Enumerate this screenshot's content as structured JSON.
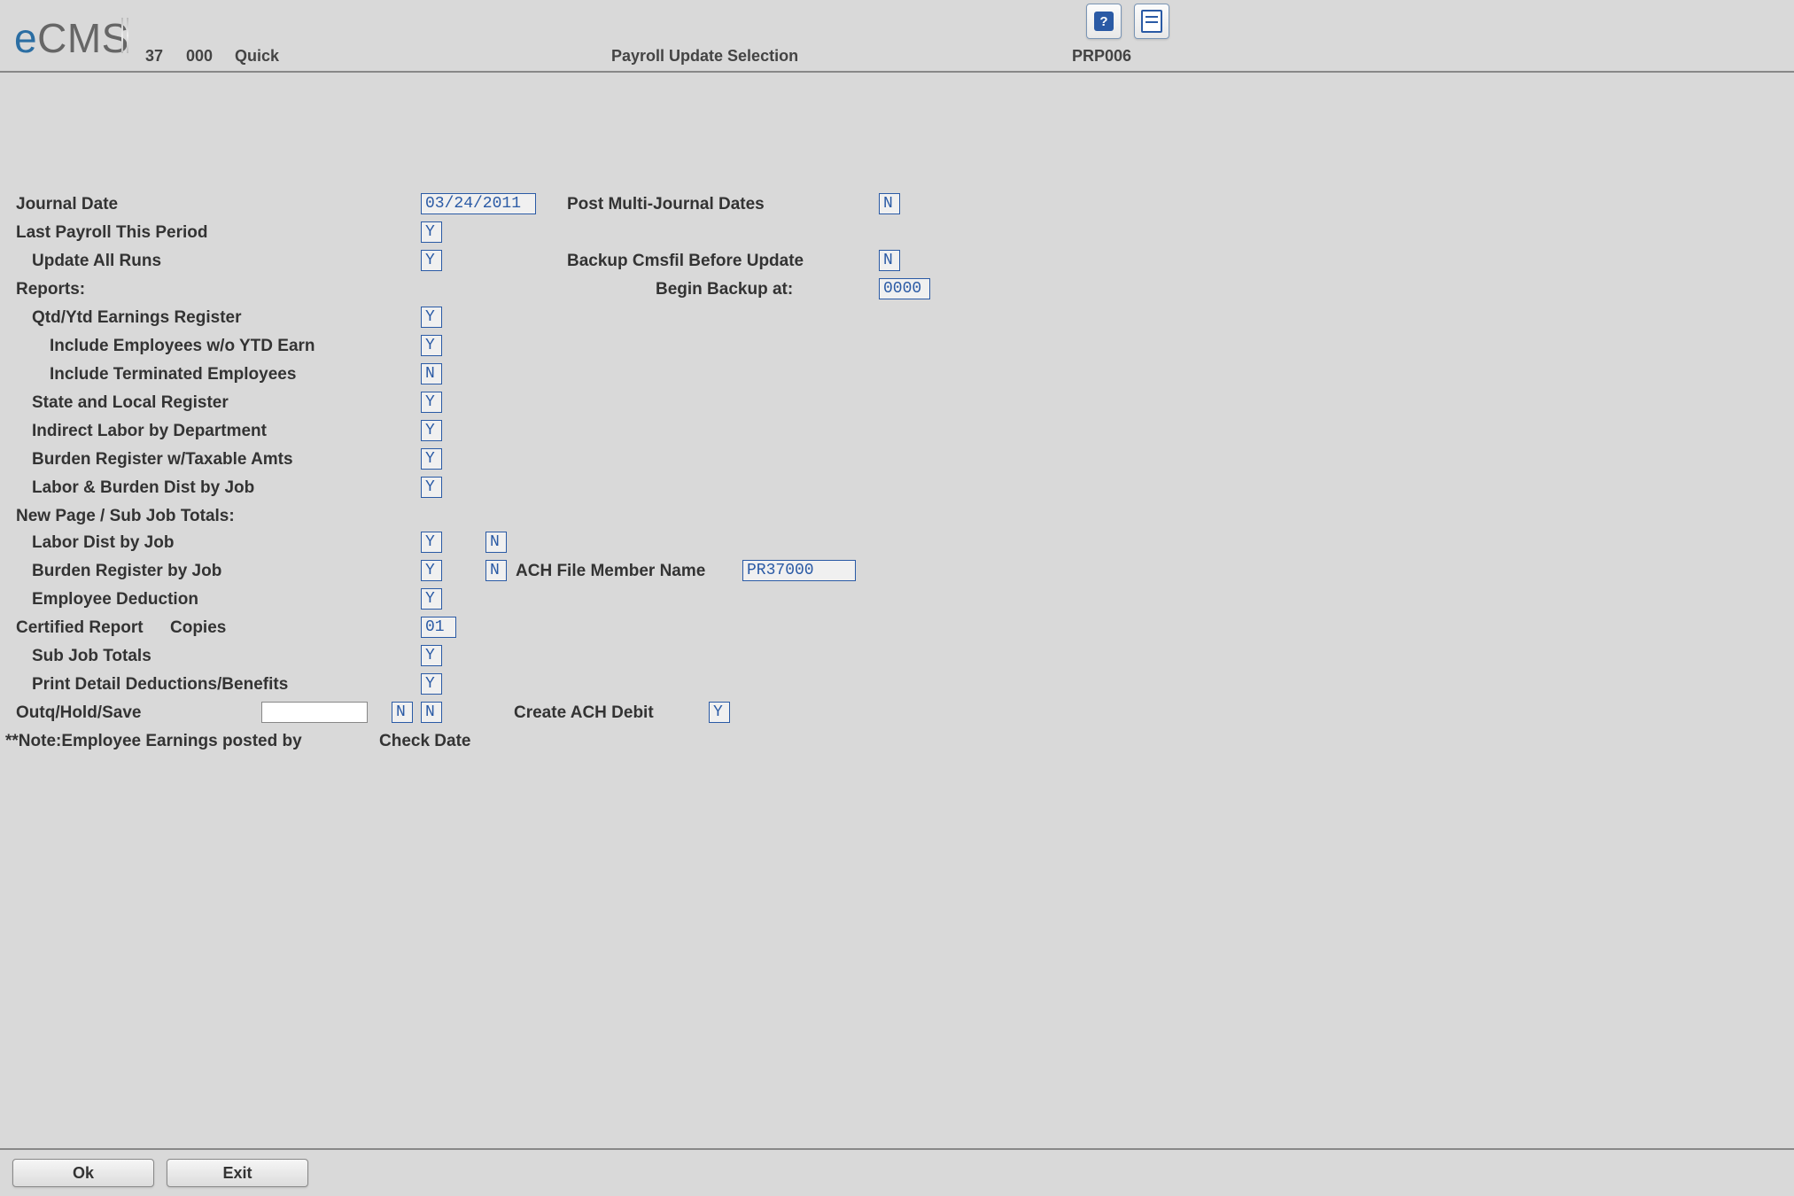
{
  "header": {
    "code1": "37",
    "code2": "000",
    "modeLabel": "Quick",
    "title": "Payroll Update Selection",
    "programId": "PRP006"
  },
  "logo": {
    "prefix": "e",
    "suffix": "CMS"
  },
  "form": {
    "journalDateLabel": "Journal Date",
    "journalDate": "03/24/2011",
    "postMultiLabel": "Post Multi-Journal Dates",
    "postMulti": "N",
    "lastPayrollLabel": "Last Payroll This Period",
    "lastPayroll": "Y",
    "updateAllRunsLabel": "Update All Runs",
    "updateAllRuns": "Y",
    "backupBeforeLabel": "Backup Cmsfil Before Update",
    "backupBefore": "N",
    "beginBackupLabel": "Begin Backup at:",
    "beginBackup": "0000",
    "reportsHeader": "Reports:",
    "qtdYtdLabel": "Qtd/Ytd Earnings Register",
    "qtdYtd": "Y",
    "inclNoYtdLabel": "Include Employees w/o YTD Earn",
    "inclNoYtd": "Y",
    "inclTermLabel": "Include Terminated Employees",
    "inclTerm": "N",
    "stateLocalLabel": "State and Local Register",
    "stateLocal": "Y",
    "indirectLaborLabel": "Indirect Labor by Department",
    "indirectLabor": "Y",
    "burdenTaxLabel": "Burden Register w/Taxable Amts",
    "burdenTax": "Y",
    "laborBurdenJobLabel": "Labor & Burden Dist by Job",
    "laborBurdenJob": "Y",
    "newPageHeader": "New Page / Sub Job Totals:",
    "laborDistJobLabel": "Labor Dist by Job",
    "laborDistJob1": "Y",
    "laborDistJob2": "N",
    "burdenRegJobLabel": "Burden Register by Job",
    "burdenRegJob1": "Y",
    "burdenRegJob2": "N",
    "achFileLabel": "ACH File Member Name",
    "achFile": "PR37000",
    "empDeductionLabel": "Employee Deduction",
    "empDeduction": "Y",
    "certReportLabel": "Certified Report",
    "copiesLabel": "Copies",
    "copies": "01",
    "subJobTotalsLabel": "Sub Job Totals",
    "subJobTotals": "Y",
    "printDetailLabel": "Print Detail Deductions/Benefits",
    "printDetail": "Y",
    "outqLabel": "Outq/Hold/Save",
    "outqValue": "",
    "outqHold": "N",
    "outqSave": "N",
    "createAchLabel": "Create ACH Debit",
    "createAch": "Y",
    "noteLabel": "**Note:Employee Earnings posted by",
    "noteValue": "Check Date"
  },
  "footer": {
    "ok": "Ok",
    "exit": "Exit"
  }
}
